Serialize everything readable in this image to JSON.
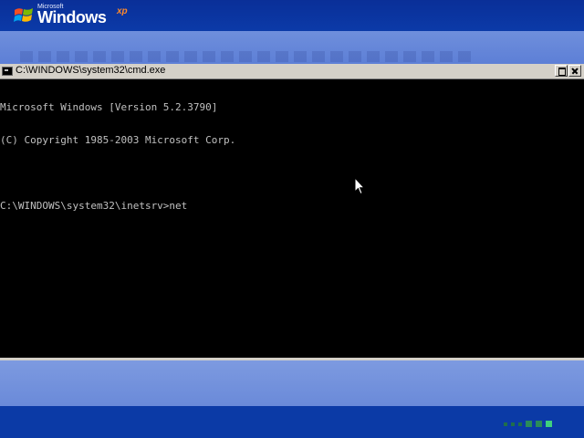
{
  "logo": {
    "microsoft": "Microsoft",
    "windows": "Windows",
    "xp": "xp"
  },
  "console": {
    "title": "C:\\WINDOWS\\system32\\cmd.exe",
    "lines": [
      "Microsoft Windows [Version 5.2.3790]",
      "(C) Copyright 1985-2003 Microsoft Corp.",
      "",
      "C:\\WINDOWS\\system32\\inetsrv>net"
    ]
  },
  "colors": {
    "console_background": "#000000",
    "console_text": "#c0c0c0",
    "setup_blue": "#0c3aa6",
    "setup_light_blue": "#6f8fdc",
    "progress_green": "#3fd07e"
  },
  "icons": {
    "console_icon": "cmd-icon",
    "restore": "restore-icon",
    "close": "close-icon",
    "cursor": "mouse-pointer-icon",
    "logo_flag": "windows-flag-icon"
  }
}
